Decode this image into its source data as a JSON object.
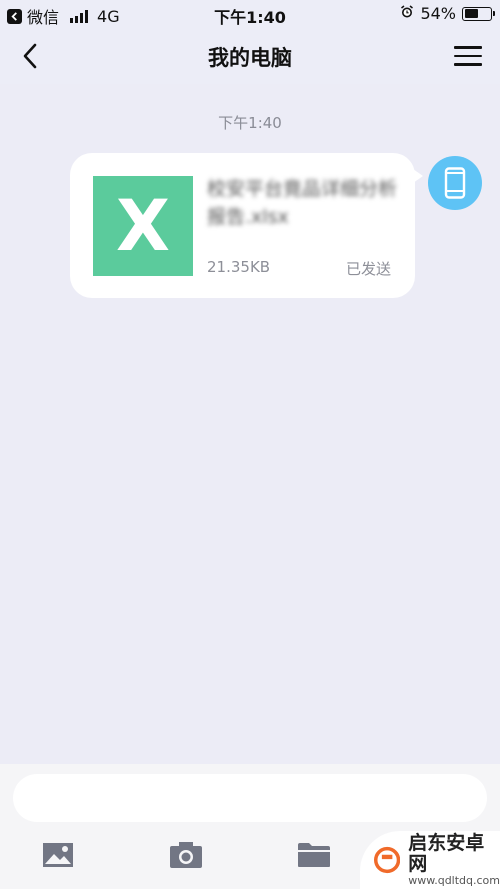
{
  "status_bar": {
    "back_app": "微信",
    "network": "4G",
    "time": "下午1:40",
    "battery_percent": "54%",
    "battery_level": 0.54
  },
  "nav": {
    "title": "我的电脑"
  },
  "chat": {
    "timestamp": "下午1:40",
    "message": {
      "file_name": "校安平台竟品详细分析报告.xlsx",
      "file_size": "21.35KB",
      "status": "已发送",
      "file_icon_letter": "X"
    }
  },
  "input": {
    "placeholder": ""
  },
  "toolbar": {
    "icons": [
      "image-icon",
      "camera-icon",
      "folder-icon",
      "more-icon"
    ]
  },
  "watermark": {
    "title": "启东安卓网",
    "url": "www.qdltdq.com"
  },
  "colors": {
    "background": "#ecedf7",
    "excel_green": "#5bcb9c",
    "avatar_blue": "#5ec3f5"
  }
}
